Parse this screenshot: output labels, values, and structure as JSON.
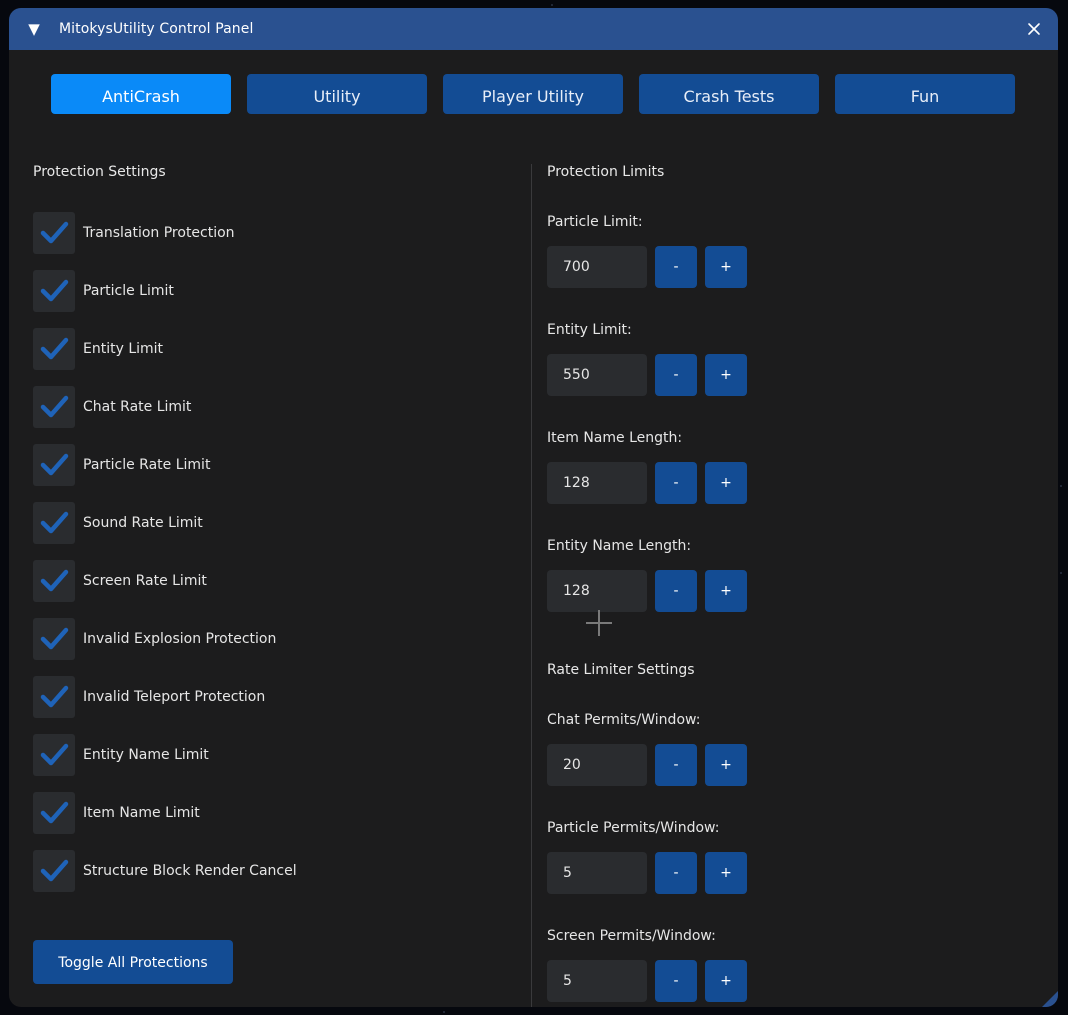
{
  "window": {
    "title": "MitokysUtility Control Panel",
    "collapse_glyph": "▼",
    "close_icon": "x-icon"
  },
  "tabs": [
    {
      "label": "AntiCrash",
      "active": true
    },
    {
      "label": "Utility",
      "active": false
    },
    {
      "label": "Player Utility",
      "active": false
    },
    {
      "label": "Crash Tests",
      "active": false
    },
    {
      "label": "Fun",
      "active": false
    }
  ],
  "protection_settings": {
    "title": "Protection Settings",
    "items": [
      {
        "label": "Translation Protection",
        "checked": true
      },
      {
        "label": "Particle Limit",
        "checked": true
      },
      {
        "label": "Entity Limit",
        "checked": true
      },
      {
        "label": "Chat Rate Limit",
        "checked": true
      },
      {
        "label": "Particle Rate Limit",
        "checked": true
      },
      {
        "label": "Sound Rate Limit",
        "checked": true
      },
      {
        "label": "Screen Rate Limit",
        "checked": true
      },
      {
        "label": "Invalid Explosion Protection",
        "checked": true
      },
      {
        "label": "Invalid Teleport Protection",
        "checked": true
      },
      {
        "label": "Entity Name Limit",
        "checked": true
      },
      {
        "label": "Item Name Limit",
        "checked": true
      },
      {
        "label": "Structure Block Render Cancel",
        "checked": true
      }
    ],
    "toggle_all_label": "Toggle All Protections"
  },
  "protection_limits": {
    "title": "Protection Limits",
    "fields": [
      {
        "label": "Particle Limit:",
        "value": "700"
      },
      {
        "label": "Entity Limit:",
        "value": "550"
      },
      {
        "label": "Item Name Length:",
        "value": "128"
      },
      {
        "label": "Entity Name Length:",
        "value": "128"
      }
    ]
  },
  "rate_limiter": {
    "title": "Rate Limiter Settings",
    "fields": [
      {
        "label": "Chat Permits/Window:",
        "value": "20"
      },
      {
        "label": "Particle Permits/Window:",
        "value": "5"
      },
      {
        "label": "Screen Permits/Window:",
        "value": "5"
      }
    ]
  },
  "stepper": {
    "minus": "-",
    "plus": "+"
  },
  "colors": {
    "titlebar": "#2a5190",
    "tab": "#134c94",
    "tab_active": "#0a8af8",
    "panel": "#1c1c1d",
    "checkmark": "#1f63b8"
  }
}
